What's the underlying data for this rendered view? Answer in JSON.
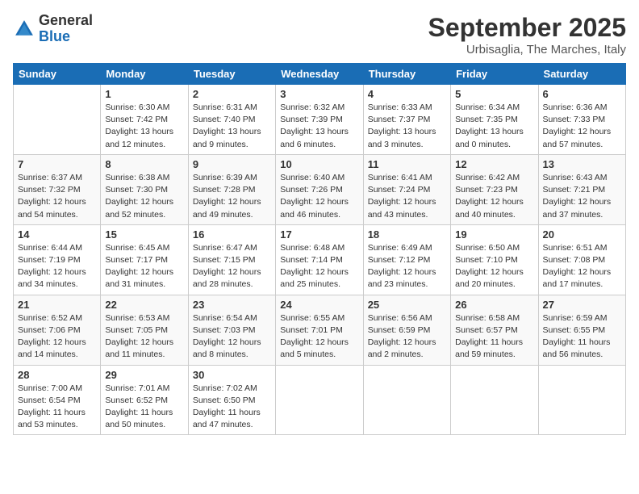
{
  "header": {
    "logo_general": "General",
    "logo_blue": "Blue",
    "month_title": "September 2025",
    "subtitle": "Urbisaglia, The Marches, Italy"
  },
  "weekdays": [
    "Sunday",
    "Monday",
    "Tuesday",
    "Wednesday",
    "Thursday",
    "Friday",
    "Saturday"
  ],
  "weeks": [
    [
      {
        "day": "",
        "info": ""
      },
      {
        "day": "1",
        "info": "Sunrise: 6:30 AM\nSunset: 7:42 PM\nDaylight: 13 hours\nand 12 minutes."
      },
      {
        "day": "2",
        "info": "Sunrise: 6:31 AM\nSunset: 7:40 PM\nDaylight: 13 hours\nand 9 minutes."
      },
      {
        "day": "3",
        "info": "Sunrise: 6:32 AM\nSunset: 7:39 PM\nDaylight: 13 hours\nand 6 minutes."
      },
      {
        "day": "4",
        "info": "Sunrise: 6:33 AM\nSunset: 7:37 PM\nDaylight: 13 hours\nand 3 minutes."
      },
      {
        "day": "5",
        "info": "Sunrise: 6:34 AM\nSunset: 7:35 PM\nDaylight: 13 hours\nand 0 minutes."
      },
      {
        "day": "6",
        "info": "Sunrise: 6:36 AM\nSunset: 7:33 PM\nDaylight: 12 hours\nand 57 minutes."
      }
    ],
    [
      {
        "day": "7",
        "info": "Sunrise: 6:37 AM\nSunset: 7:32 PM\nDaylight: 12 hours\nand 54 minutes."
      },
      {
        "day": "8",
        "info": "Sunrise: 6:38 AM\nSunset: 7:30 PM\nDaylight: 12 hours\nand 52 minutes."
      },
      {
        "day": "9",
        "info": "Sunrise: 6:39 AM\nSunset: 7:28 PM\nDaylight: 12 hours\nand 49 minutes."
      },
      {
        "day": "10",
        "info": "Sunrise: 6:40 AM\nSunset: 7:26 PM\nDaylight: 12 hours\nand 46 minutes."
      },
      {
        "day": "11",
        "info": "Sunrise: 6:41 AM\nSunset: 7:24 PM\nDaylight: 12 hours\nand 43 minutes."
      },
      {
        "day": "12",
        "info": "Sunrise: 6:42 AM\nSunset: 7:23 PM\nDaylight: 12 hours\nand 40 minutes."
      },
      {
        "day": "13",
        "info": "Sunrise: 6:43 AM\nSunset: 7:21 PM\nDaylight: 12 hours\nand 37 minutes."
      }
    ],
    [
      {
        "day": "14",
        "info": "Sunrise: 6:44 AM\nSunset: 7:19 PM\nDaylight: 12 hours\nand 34 minutes."
      },
      {
        "day": "15",
        "info": "Sunrise: 6:45 AM\nSunset: 7:17 PM\nDaylight: 12 hours\nand 31 minutes."
      },
      {
        "day": "16",
        "info": "Sunrise: 6:47 AM\nSunset: 7:15 PM\nDaylight: 12 hours\nand 28 minutes."
      },
      {
        "day": "17",
        "info": "Sunrise: 6:48 AM\nSunset: 7:14 PM\nDaylight: 12 hours\nand 25 minutes."
      },
      {
        "day": "18",
        "info": "Sunrise: 6:49 AM\nSunset: 7:12 PM\nDaylight: 12 hours\nand 23 minutes."
      },
      {
        "day": "19",
        "info": "Sunrise: 6:50 AM\nSunset: 7:10 PM\nDaylight: 12 hours\nand 20 minutes."
      },
      {
        "day": "20",
        "info": "Sunrise: 6:51 AM\nSunset: 7:08 PM\nDaylight: 12 hours\nand 17 minutes."
      }
    ],
    [
      {
        "day": "21",
        "info": "Sunrise: 6:52 AM\nSunset: 7:06 PM\nDaylight: 12 hours\nand 14 minutes."
      },
      {
        "day": "22",
        "info": "Sunrise: 6:53 AM\nSunset: 7:05 PM\nDaylight: 12 hours\nand 11 minutes."
      },
      {
        "day": "23",
        "info": "Sunrise: 6:54 AM\nSunset: 7:03 PM\nDaylight: 12 hours\nand 8 minutes."
      },
      {
        "day": "24",
        "info": "Sunrise: 6:55 AM\nSunset: 7:01 PM\nDaylight: 12 hours\nand 5 minutes."
      },
      {
        "day": "25",
        "info": "Sunrise: 6:56 AM\nSunset: 6:59 PM\nDaylight: 12 hours\nand 2 minutes."
      },
      {
        "day": "26",
        "info": "Sunrise: 6:58 AM\nSunset: 6:57 PM\nDaylight: 11 hours\nand 59 minutes."
      },
      {
        "day": "27",
        "info": "Sunrise: 6:59 AM\nSunset: 6:55 PM\nDaylight: 11 hours\nand 56 minutes."
      }
    ],
    [
      {
        "day": "28",
        "info": "Sunrise: 7:00 AM\nSunset: 6:54 PM\nDaylight: 11 hours\nand 53 minutes."
      },
      {
        "day": "29",
        "info": "Sunrise: 7:01 AM\nSunset: 6:52 PM\nDaylight: 11 hours\nand 50 minutes."
      },
      {
        "day": "30",
        "info": "Sunrise: 7:02 AM\nSunset: 6:50 PM\nDaylight: 11 hours\nand 47 minutes."
      },
      {
        "day": "",
        "info": ""
      },
      {
        "day": "",
        "info": ""
      },
      {
        "day": "",
        "info": ""
      },
      {
        "day": "",
        "info": ""
      }
    ]
  ]
}
